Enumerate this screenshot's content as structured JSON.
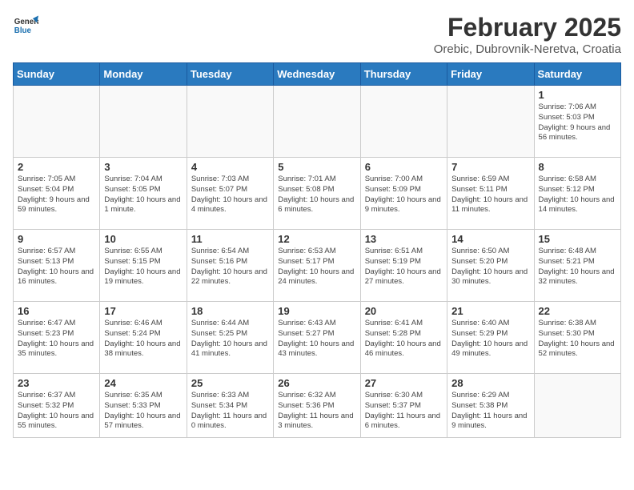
{
  "header": {
    "logo_general": "General",
    "logo_blue": "Blue",
    "month": "February 2025",
    "location": "Orebic, Dubrovnik-Neretva, Croatia"
  },
  "days_of_week": [
    "Sunday",
    "Monday",
    "Tuesday",
    "Wednesday",
    "Thursday",
    "Friday",
    "Saturday"
  ],
  "weeks": [
    [
      {
        "num": "",
        "info": ""
      },
      {
        "num": "",
        "info": ""
      },
      {
        "num": "",
        "info": ""
      },
      {
        "num": "",
        "info": ""
      },
      {
        "num": "",
        "info": ""
      },
      {
        "num": "",
        "info": ""
      },
      {
        "num": "1",
        "info": "Sunrise: 7:06 AM\nSunset: 5:03 PM\nDaylight: 9 hours and 56 minutes."
      }
    ],
    [
      {
        "num": "2",
        "info": "Sunrise: 7:05 AM\nSunset: 5:04 PM\nDaylight: 9 hours and 59 minutes."
      },
      {
        "num": "3",
        "info": "Sunrise: 7:04 AM\nSunset: 5:05 PM\nDaylight: 10 hours and 1 minute."
      },
      {
        "num": "4",
        "info": "Sunrise: 7:03 AM\nSunset: 5:07 PM\nDaylight: 10 hours and 4 minutes."
      },
      {
        "num": "5",
        "info": "Sunrise: 7:01 AM\nSunset: 5:08 PM\nDaylight: 10 hours and 6 minutes."
      },
      {
        "num": "6",
        "info": "Sunrise: 7:00 AM\nSunset: 5:09 PM\nDaylight: 10 hours and 9 minutes."
      },
      {
        "num": "7",
        "info": "Sunrise: 6:59 AM\nSunset: 5:11 PM\nDaylight: 10 hours and 11 minutes."
      },
      {
        "num": "8",
        "info": "Sunrise: 6:58 AM\nSunset: 5:12 PM\nDaylight: 10 hours and 14 minutes."
      }
    ],
    [
      {
        "num": "9",
        "info": "Sunrise: 6:57 AM\nSunset: 5:13 PM\nDaylight: 10 hours and 16 minutes."
      },
      {
        "num": "10",
        "info": "Sunrise: 6:55 AM\nSunset: 5:15 PM\nDaylight: 10 hours and 19 minutes."
      },
      {
        "num": "11",
        "info": "Sunrise: 6:54 AM\nSunset: 5:16 PM\nDaylight: 10 hours and 22 minutes."
      },
      {
        "num": "12",
        "info": "Sunrise: 6:53 AM\nSunset: 5:17 PM\nDaylight: 10 hours and 24 minutes."
      },
      {
        "num": "13",
        "info": "Sunrise: 6:51 AM\nSunset: 5:19 PM\nDaylight: 10 hours and 27 minutes."
      },
      {
        "num": "14",
        "info": "Sunrise: 6:50 AM\nSunset: 5:20 PM\nDaylight: 10 hours and 30 minutes."
      },
      {
        "num": "15",
        "info": "Sunrise: 6:48 AM\nSunset: 5:21 PM\nDaylight: 10 hours and 32 minutes."
      }
    ],
    [
      {
        "num": "16",
        "info": "Sunrise: 6:47 AM\nSunset: 5:23 PM\nDaylight: 10 hours and 35 minutes."
      },
      {
        "num": "17",
        "info": "Sunrise: 6:46 AM\nSunset: 5:24 PM\nDaylight: 10 hours and 38 minutes."
      },
      {
        "num": "18",
        "info": "Sunrise: 6:44 AM\nSunset: 5:25 PM\nDaylight: 10 hours and 41 minutes."
      },
      {
        "num": "19",
        "info": "Sunrise: 6:43 AM\nSunset: 5:27 PM\nDaylight: 10 hours and 43 minutes."
      },
      {
        "num": "20",
        "info": "Sunrise: 6:41 AM\nSunset: 5:28 PM\nDaylight: 10 hours and 46 minutes."
      },
      {
        "num": "21",
        "info": "Sunrise: 6:40 AM\nSunset: 5:29 PM\nDaylight: 10 hours and 49 minutes."
      },
      {
        "num": "22",
        "info": "Sunrise: 6:38 AM\nSunset: 5:30 PM\nDaylight: 10 hours and 52 minutes."
      }
    ],
    [
      {
        "num": "23",
        "info": "Sunrise: 6:37 AM\nSunset: 5:32 PM\nDaylight: 10 hours and 55 minutes."
      },
      {
        "num": "24",
        "info": "Sunrise: 6:35 AM\nSunset: 5:33 PM\nDaylight: 10 hours and 57 minutes."
      },
      {
        "num": "25",
        "info": "Sunrise: 6:33 AM\nSunset: 5:34 PM\nDaylight: 11 hours and 0 minutes."
      },
      {
        "num": "26",
        "info": "Sunrise: 6:32 AM\nSunset: 5:36 PM\nDaylight: 11 hours and 3 minutes."
      },
      {
        "num": "27",
        "info": "Sunrise: 6:30 AM\nSunset: 5:37 PM\nDaylight: 11 hours and 6 minutes."
      },
      {
        "num": "28",
        "info": "Sunrise: 6:29 AM\nSunset: 5:38 PM\nDaylight: 11 hours and 9 minutes."
      },
      {
        "num": "",
        "info": ""
      }
    ]
  ]
}
